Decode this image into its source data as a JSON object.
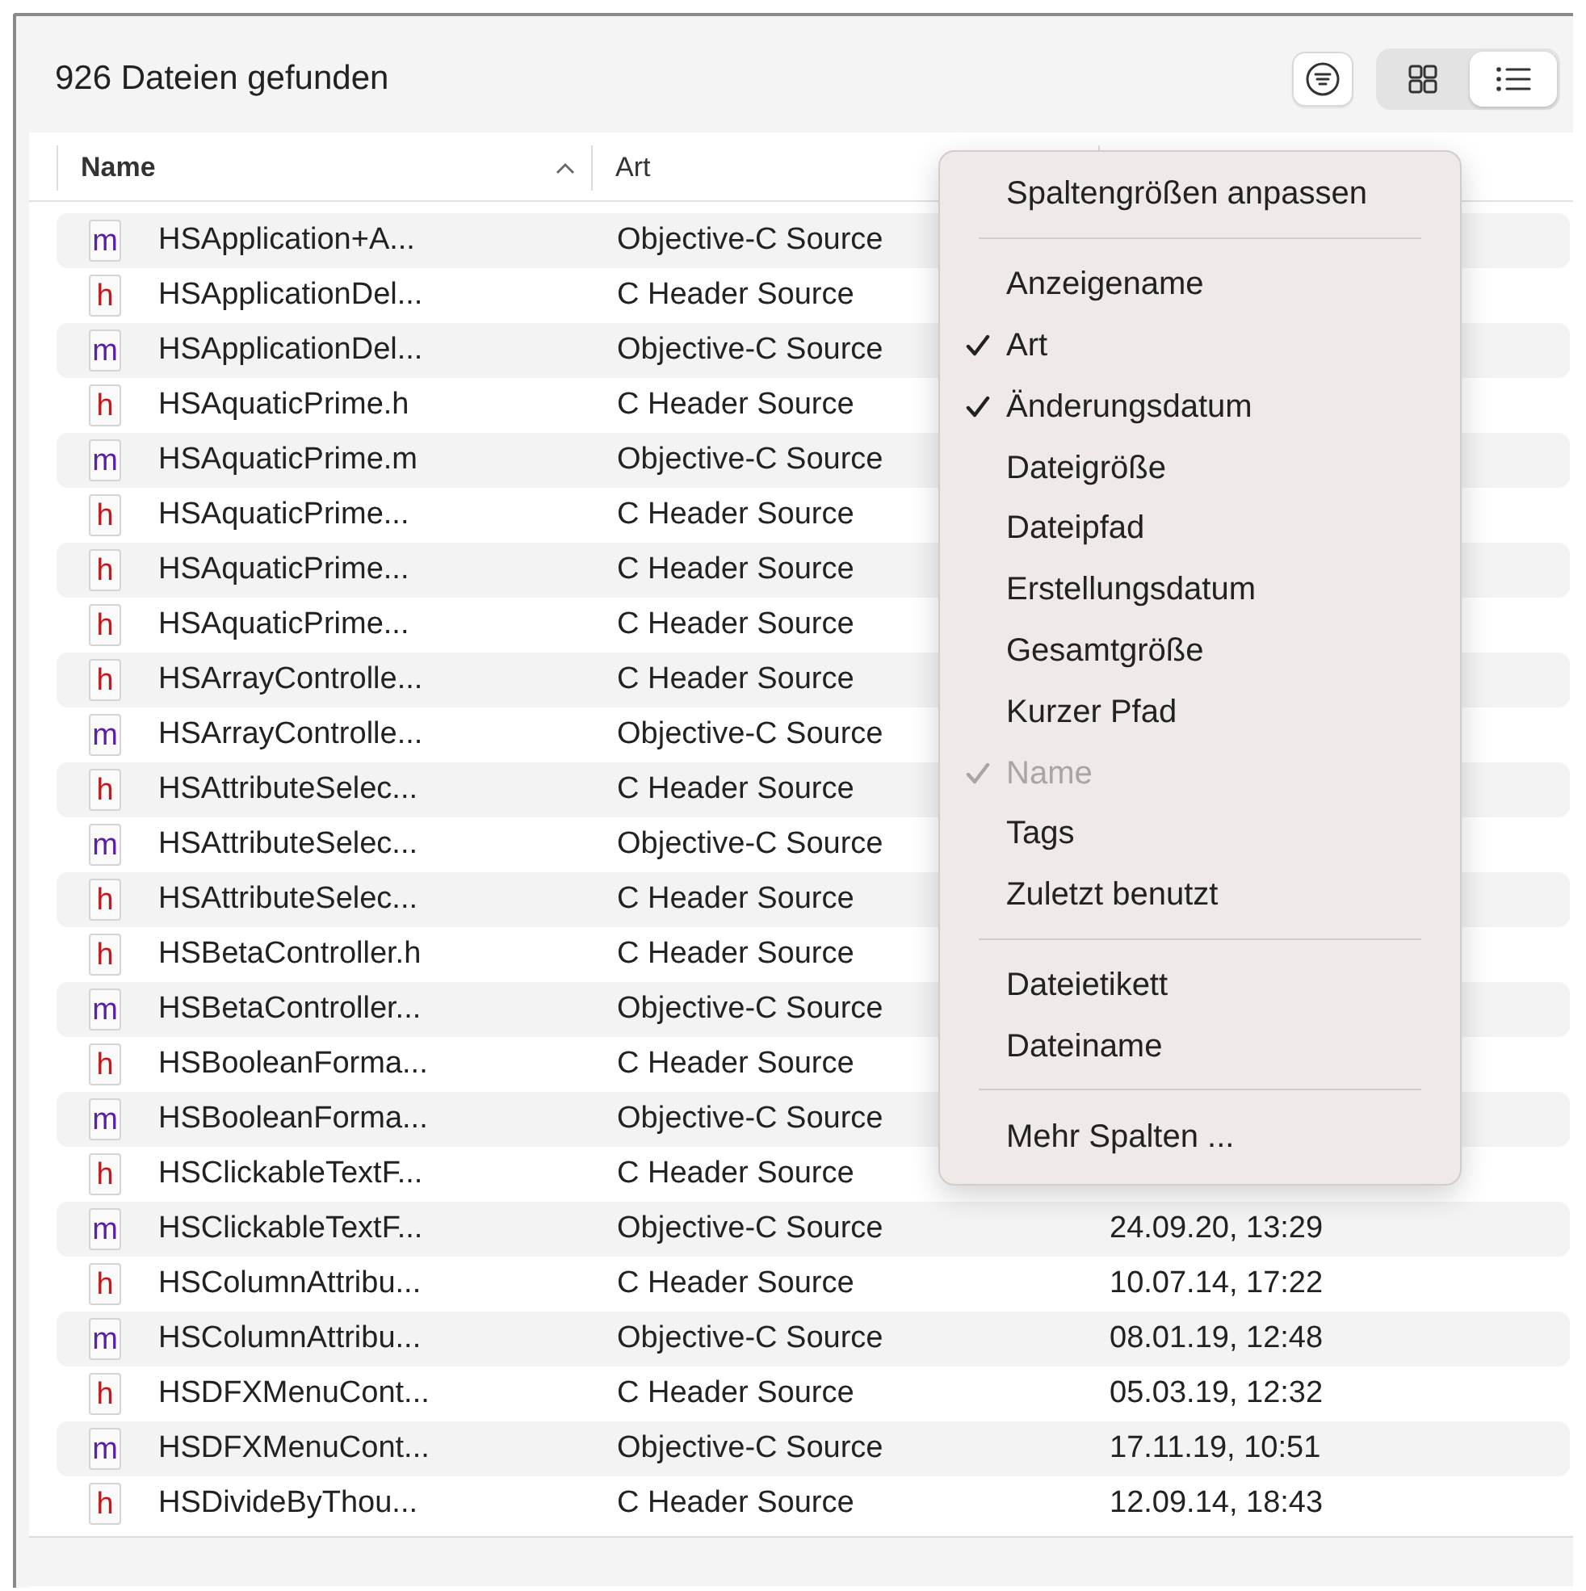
{
  "toolbar": {
    "title": "926 Dateien gefunden",
    "view_buttons": [
      {
        "kind": "grid",
        "selected": false
      },
      {
        "kind": "list",
        "selected": true
      }
    ]
  },
  "table": {
    "columns": [
      {
        "label": "Name",
        "sorted": true
      },
      {
        "label": "Art",
        "sorted": false
      },
      {
        "sorted": false
      }
    ],
    "rows": [
      {
        "icon_letter": "m",
        "kind": "m",
        "name": "HSApplication+A...",
        "type": "Objective-C Source"
      },
      {
        "icon_letter": "h",
        "kind": "h",
        "name": "HSApplicationDel...",
        "type": "C Header Source"
      },
      {
        "icon_letter": "m",
        "kind": "m",
        "name": "HSApplicationDel...",
        "type": "Objective-C Source"
      },
      {
        "icon_letter": "h",
        "kind": "h",
        "name": "HSAquaticPrime.h",
        "type": "C Header Source"
      },
      {
        "icon_letter": "m",
        "kind": "m",
        "name": "HSAquaticPrime.m",
        "type": "Objective-C Source"
      },
      {
        "icon_letter": "h",
        "kind": "h",
        "name": "HSAquaticPrime...",
        "type": "C Header Source"
      },
      {
        "icon_letter": "h",
        "kind": "h",
        "name": "HSAquaticPrime...",
        "type": "C Header Source"
      },
      {
        "icon_letter": "h",
        "kind": "h",
        "name": "HSAquaticPrime...",
        "type": "C Header Source"
      },
      {
        "icon_letter": "h",
        "kind": "h",
        "name": "HSArrayControlle...",
        "type": "C Header Source"
      },
      {
        "icon_letter": "m",
        "kind": "m",
        "name": "HSArrayControlle...",
        "type": "Objective-C Source"
      },
      {
        "icon_letter": "h",
        "kind": "h",
        "name": "HSAttributeSelec...",
        "type": "C Header Source"
      },
      {
        "icon_letter": "m",
        "kind": "m",
        "name": "HSAttributeSelec...",
        "type": "Objective-C Source"
      },
      {
        "icon_letter": "h",
        "kind": "h",
        "name": "HSAttributeSelec...",
        "type": "C Header Source"
      },
      {
        "icon_letter": "h",
        "kind": "h",
        "name": "HSBetaController.h",
        "type": "C Header Source"
      },
      {
        "icon_letter": "m",
        "kind": "m",
        "name": "HSBetaController...",
        "type": "Objective-C Source"
      },
      {
        "icon_letter": "h",
        "kind": "h",
        "name": "HSBooleanForma...",
        "type": "C Header Source"
      },
      {
        "icon_letter": "m",
        "kind": "m",
        "name": "HSBooleanForma...",
        "type": "Objective-C Source"
      },
      {
        "icon_letter": "h",
        "kind": "h",
        "name": "HSClickableTextF...",
        "type": "C Header Source"
      },
      {
        "icon_letter": "m",
        "kind": "m",
        "name": "HSClickableTextF...",
        "type": "Objective-C Source",
        "date": "24.09.20, 13:29"
      },
      {
        "icon_letter": "h",
        "kind": "h",
        "name": "HSColumnAttribu...",
        "type": "C Header Source",
        "date": "10.07.14, 17:22"
      },
      {
        "icon_letter": "m",
        "kind": "m",
        "name": "HSColumnAttribu...",
        "type": "Objective-C Source",
        "date": "08.01.19, 12:48"
      },
      {
        "icon_letter": "h",
        "kind": "h",
        "name": "HSDFXMenuCont...",
        "type": "C Header Source",
        "date": "05.03.19, 12:32"
      },
      {
        "icon_letter": "m",
        "kind": "m",
        "name": "HSDFXMenuCont...",
        "type": "Objective-C Source",
        "date": "17.11.19, 10:51"
      },
      {
        "icon_letter": "h",
        "kind": "h",
        "name": "HSDivideByThou...",
        "type": "C Header Source",
        "date": "12.09.14, 18:43"
      }
    ]
  },
  "context_menu": {
    "items": [
      {
        "kind": "item",
        "label": "Spaltengrößen anpassen",
        "checked": false,
        "disabled": false
      },
      {
        "kind": "separator"
      },
      {
        "kind": "item",
        "label": "Anzeigename",
        "checked": false,
        "disabled": false
      },
      {
        "kind": "item",
        "label": "Art",
        "checked": true,
        "disabled": false
      },
      {
        "kind": "item",
        "label": "Änderungsdatum",
        "checked": true,
        "disabled": false
      },
      {
        "kind": "item",
        "label": "Dateigröße",
        "checked": false,
        "disabled": false
      },
      {
        "kind": "item",
        "label": "Dateipfad",
        "checked": false,
        "disabled": false
      },
      {
        "kind": "item",
        "label": "Erstellungsdatum",
        "checked": false,
        "disabled": false
      },
      {
        "kind": "item",
        "label": "Gesamtgröße",
        "checked": false,
        "disabled": false
      },
      {
        "kind": "item",
        "label": "Kurzer Pfad",
        "checked": false,
        "disabled": false
      },
      {
        "kind": "item",
        "label": "Name",
        "checked": true,
        "disabled": true
      },
      {
        "kind": "item",
        "label": "Tags",
        "checked": false,
        "disabled": false
      },
      {
        "kind": "item",
        "label": "Zuletzt benutzt",
        "checked": false,
        "disabled": false
      },
      {
        "kind": "separator"
      },
      {
        "kind": "item",
        "label": "Dateietikett",
        "checked": false,
        "disabled": false
      },
      {
        "kind": "item",
        "label": "Dateiname",
        "checked": false,
        "disabled": false
      },
      {
        "kind": "separator"
      },
      {
        "kind": "item",
        "label": "Mehr Spalten ...",
        "checked": false,
        "disabled": false
      }
    ]
  }
}
